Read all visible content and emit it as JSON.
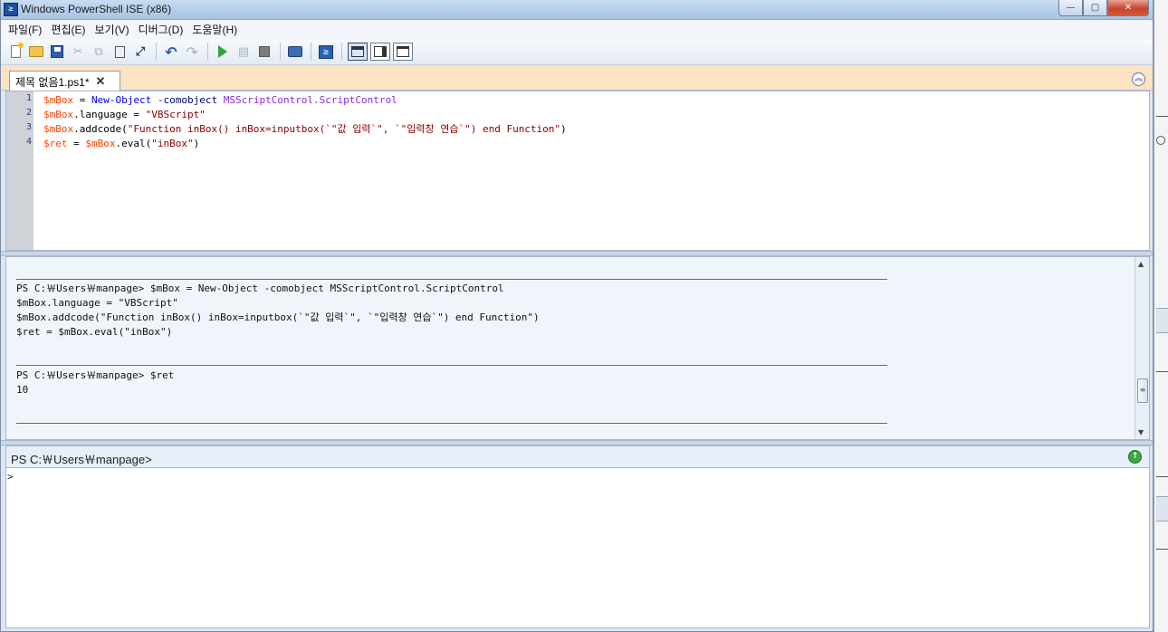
{
  "window": {
    "title": "Windows PowerShell ISE (x86)",
    "minimize": "—",
    "maximize": "▢",
    "close": "✕"
  },
  "menu": {
    "items": [
      "파일(F)",
      "편집(E)",
      "보기(V)",
      "디버그(D)",
      "도움말(H)"
    ]
  },
  "toolbar": {
    "cut": "✂",
    "copy": "⧉",
    "paste": "📋",
    "clear": "⤢",
    "undo": "↶",
    "redo": "↷",
    "run_selection": "▤",
    "ps_glyph": "≥"
  },
  "tabs": [
    {
      "label": "제목 없음1.ps1*",
      "close": "✕"
    }
  ],
  "script_pane": {
    "collapse_glyph": "︽",
    "lines": [
      {
        "num": "1",
        "tokens": [
          [
            "var",
            "$mBox"
          ],
          [
            "plain",
            " = "
          ],
          [
            "cmd",
            "New-Object"
          ],
          [
            "plain",
            " "
          ],
          [
            "par",
            "-comobject"
          ],
          [
            "plain",
            " "
          ],
          [
            "typ",
            "MSScriptControl.ScriptControl"
          ]
        ]
      },
      {
        "num": "2",
        "tokens": [
          [
            "var",
            "$mBox"
          ],
          [
            "plain",
            ".language = "
          ],
          [
            "str",
            "\"VBScript\""
          ]
        ]
      },
      {
        "num": "3",
        "tokens": [
          [
            "var",
            "$mBox"
          ],
          [
            "plain",
            ".addcode("
          ],
          [
            "str",
            "\"Function inBox() inBox=inputbox(`\"값 입력`\", `\"입력창 연습`\") end Function\""
          ],
          [
            "plain",
            ")"
          ]
        ]
      },
      {
        "num": "4",
        "tokens": [
          [
            "var",
            "$ret"
          ],
          [
            "plain",
            " = "
          ],
          [
            "var",
            "$mBox"
          ],
          [
            "plain",
            ".eval("
          ],
          [
            "str",
            "\"inBox\""
          ],
          [
            "plain",
            ")"
          ]
        ]
      }
    ]
  },
  "output_pane": {
    "lines": [
      "PS C:￦Users￦manpage> $mBox = New-Object -comobject MSScriptControl.ScriptControl",
      "$mBox.language = \"VBScript\"",
      "$mBox.addcode(\"Function inBox() inBox=inputbox(`\"값 입력`\", `\"입력창 연습`\") end Function\")",
      "$ret = $mBox.eval(\"inBox\")",
      "PS C:￦Users￦manpage> $ret",
      "10"
    ],
    "scroll_up": "▲",
    "scroll_down": "▼",
    "thumb_grip": "≡"
  },
  "command_pane": {
    "prompt_label": "PS C:￦Users￦manpage>",
    "input_prompt": ">",
    "go_glyph": "↑"
  },
  "colors": {
    "variable": "#ff4500",
    "command": "#0000ff",
    "parameter": "#000080",
    "type": "#8a2be2",
    "string": "#8b0000",
    "tabstrip": "#fbe3c4",
    "output_bg": "#f0f5fb"
  }
}
